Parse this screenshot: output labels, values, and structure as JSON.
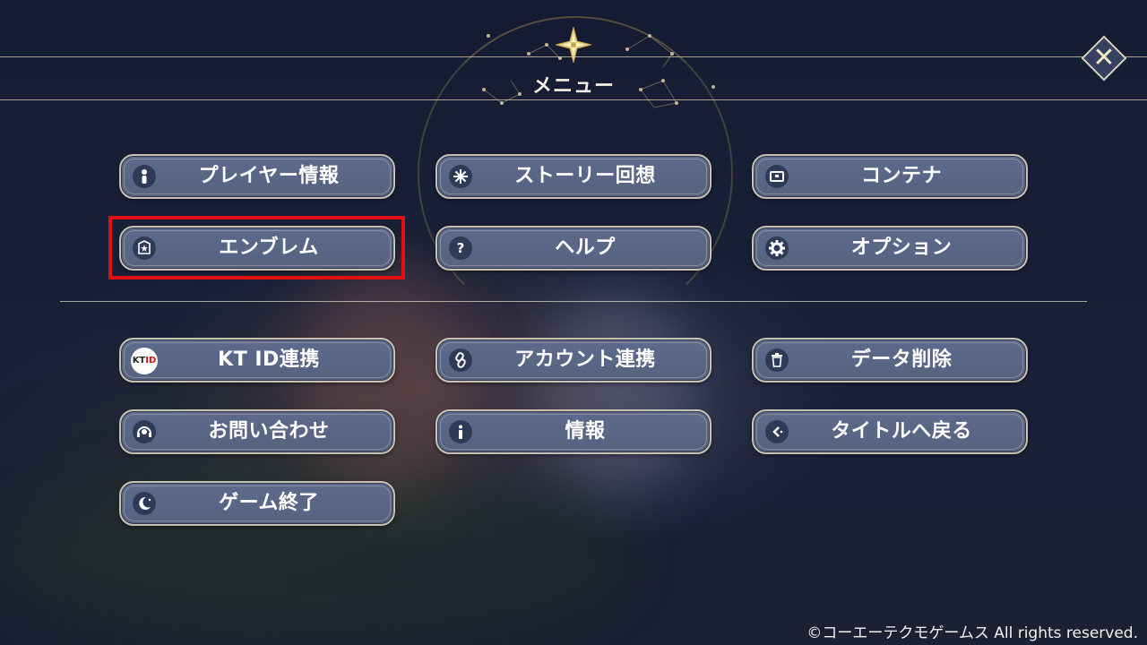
{
  "header": {
    "title": "メニュー",
    "close_label": "✕"
  },
  "colors": {
    "button_fill": "#5b6888",
    "button_border": "#c8c2b2",
    "highlight": "#e01010",
    "background": "#1a2038"
  },
  "menu_top": [
    {
      "label": "プレイヤー情報",
      "icon": "player-icon"
    },
    {
      "label": "ストーリー回想",
      "icon": "sparkle-icon"
    },
    {
      "label": "コンテナ",
      "icon": "container-icon"
    },
    {
      "label": "エンブレム",
      "icon": "emblem-icon",
      "highlighted": true
    },
    {
      "label": "ヘルプ",
      "icon": "question-icon"
    },
    {
      "label": "オプション",
      "icon": "gear-icon"
    }
  ],
  "menu_bottom": [
    {
      "label": "KT ID連携",
      "icon": "ktid-icon",
      "icon_text_a": "KT",
      "icon_text_b": "ID"
    },
    {
      "label": "アカウント連携",
      "icon": "link-icon"
    },
    {
      "label": "データ削除",
      "icon": "trash-icon"
    },
    {
      "label": "お問い合わせ",
      "icon": "headset-icon"
    },
    {
      "label": "情報",
      "icon": "info-icon"
    },
    {
      "label": "タイトルへ戻る",
      "icon": "back-arrow-icon"
    },
    {
      "label": "ゲーム終了",
      "icon": "moon-icon"
    }
  ],
  "footer": {
    "copyright": "©コーエーテクモゲームス All rights reserved."
  }
}
